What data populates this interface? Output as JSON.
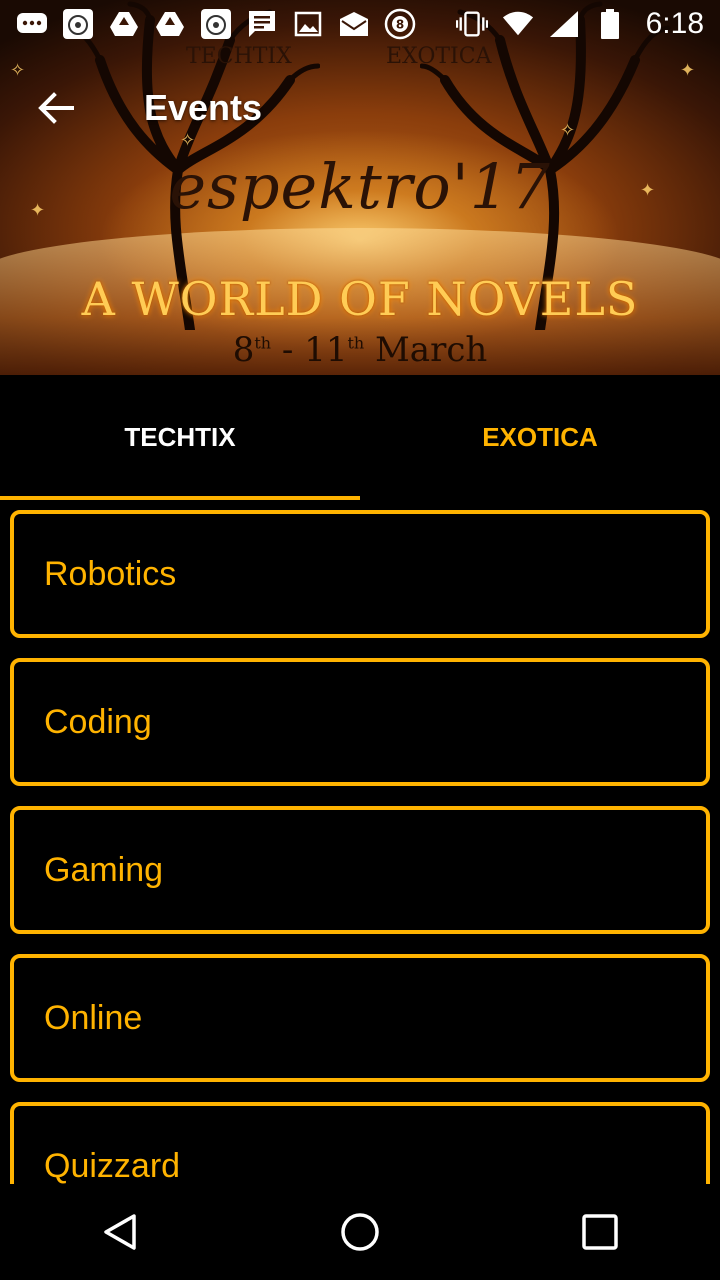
{
  "status_bar": {
    "time": "6:18",
    "left_icons": [
      "chat-bubble-icon",
      "app-badge-icon",
      "drive-icon",
      "drive-icon",
      "app-badge-icon",
      "message-icon",
      "image-icon",
      "mail-icon",
      "eight-ball-icon"
    ],
    "right_icons": [
      "vibrate-icon",
      "wifi-icon",
      "signal-icon",
      "battery-icon"
    ]
  },
  "app_bar": {
    "title": "Events"
  },
  "banner": {
    "title": "espektro'17",
    "tagline": "A WORLD OF NOVELS",
    "date_start": "8",
    "date_start_sup": "th",
    "date_sep": " - ",
    "date_end": "11",
    "date_end_sup": "th",
    "date_month": " March",
    "mark_left": "TECHTIX",
    "mark_right": "EXOTICA"
  },
  "tabs": [
    {
      "label": "TECHTIX",
      "selected": true
    },
    {
      "label": "EXOTICA",
      "selected": false
    }
  ],
  "events": [
    {
      "label": "Robotics"
    },
    {
      "label": "Coding"
    },
    {
      "label": "Gaming"
    },
    {
      "label": "Online"
    },
    {
      "label": "Quizzard"
    }
  ],
  "colors": {
    "accent": "#ffb300",
    "background": "#000000",
    "text": "#ffffff"
  },
  "nav": {
    "back": "back-triangle-icon",
    "home": "home-circle-icon",
    "recents": "recents-square-icon"
  }
}
